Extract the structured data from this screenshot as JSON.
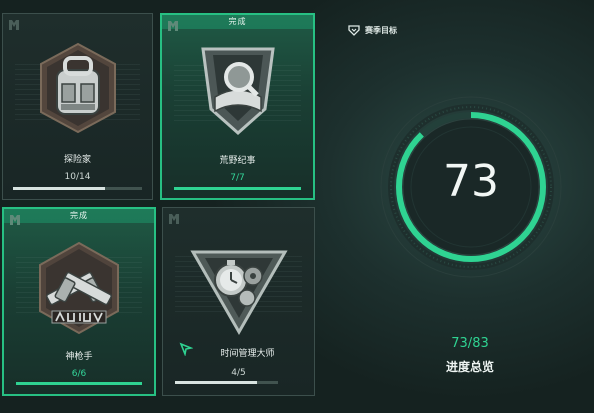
{
  "season": {
    "label": "赛季目标",
    "icon": "season-goal-icon"
  },
  "overview": {
    "value": "73",
    "score": "73/83",
    "label": "进度总览",
    "progress": 0.88
  },
  "cards": [
    {
      "name": "探险家",
      "progress_text": "10/14",
      "progress": 0.714,
      "completed": false,
      "badge": "",
      "emblem": "backpack-emblem"
    },
    {
      "name": "荒野纪事",
      "progress_text": "7/7",
      "progress": 1.0,
      "completed": true,
      "badge": "完成",
      "emblem": "book-magnifier-emblem"
    },
    {
      "name": "神枪手",
      "progress_text": "6/6",
      "progress": 1.0,
      "completed": true,
      "badge": "完成",
      "emblem": "crossed-pistols-emblem"
    },
    {
      "name": "时间管理大师",
      "progress_text": "4/5",
      "progress": 0.8,
      "completed": false,
      "badge": "",
      "emblem": "stopwatch-gears-emblem"
    }
  ],
  "colors": {
    "accent": "#2fd392",
    "card_done_border": "#27c083",
    "card_border": "#3c4f4c"
  }
}
